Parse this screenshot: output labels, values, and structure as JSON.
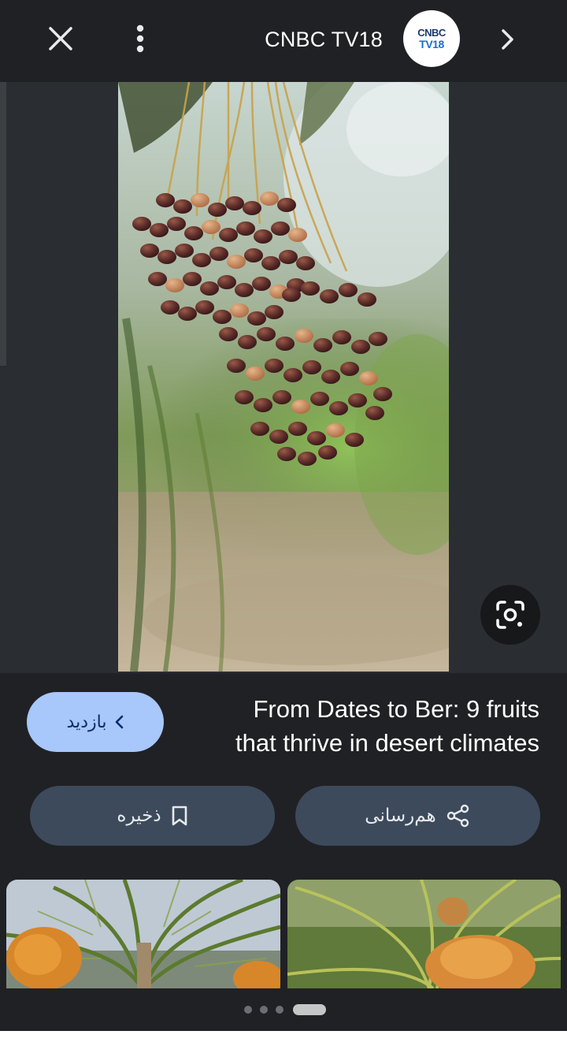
{
  "header": {
    "close_icon": "close-icon",
    "more_icon": "more-vert-icon",
    "source_name": "CNBC TV18",
    "logo_line1": "CNBC",
    "logo_line2": "TV18",
    "next_icon": "chevron-right-icon"
  },
  "viewer": {
    "lens_icon": "google-lens-icon"
  },
  "article": {
    "title_line1": "From Dates to Ber: 9 fruits",
    "title_line2": "that thrive in desert climates",
    "visit_label": "بازدید",
    "visit_icon": "chevron-left-icon"
  },
  "actions": {
    "save_label": "ذخیره",
    "save_icon": "bookmark-icon",
    "share_label": "هم‌رسانی",
    "share_icon": "share-icon"
  },
  "pagination": {
    "count": 4,
    "active_index": 3
  },
  "colors": {
    "background": "#202124",
    "visit_button": "#a8c7fa",
    "action_button": "#3c4a5c"
  }
}
